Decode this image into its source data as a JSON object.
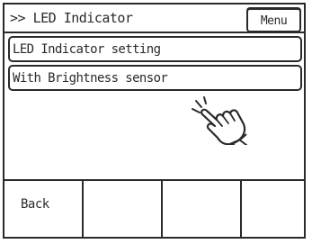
{
  "header": {
    "title": ">> LED Indicator",
    "menu_label": "Menu"
  },
  "items": [
    {
      "label": "LED Indicator setting"
    },
    {
      "label": "With Brightness sensor"
    }
  ],
  "soft_keys": [
    {
      "label": "Back"
    },
    {
      "label": ""
    },
    {
      "label": ""
    },
    {
      "label": ""
    }
  ],
  "pointer": {
    "icon": "pointing-hand-icon"
  }
}
